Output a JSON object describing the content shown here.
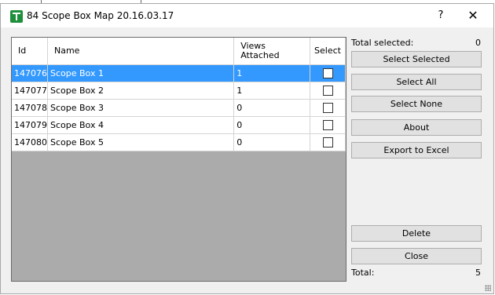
{
  "window": {
    "title": "84 Scope Box Map 20.16.03.17",
    "help_glyph": "?",
    "close_glyph": "✕",
    "icon": "app-logo-icon"
  },
  "grid": {
    "columns": [
      {
        "key": "id",
        "label": "Id"
      },
      {
        "key": "name",
        "label": "Name"
      },
      {
        "key": "views",
        "label": "Views\nAttached"
      },
      {
        "key": "select",
        "label": "Select"
      }
    ],
    "rows": [
      {
        "id": "147076",
        "name": "Scope Box 1",
        "views": "1",
        "checked": false,
        "selected": true
      },
      {
        "id": "147077",
        "name": "Scope Box 2",
        "views": "1",
        "checked": false,
        "selected": false
      },
      {
        "id": "147078",
        "name": "Scope Box 3",
        "views": "0",
        "checked": false,
        "selected": false
      },
      {
        "id": "147079",
        "name": "Scope Box 4",
        "views": "0",
        "checked": false,
        "selected": false
      },
      {
        "id": "147080",
        "name": "Scope Box 5",
        "views": "0",
        "checked": false,
        "selected": false
      }
    ]
  },
  "summary": {
    "total_selected_label": "Total selected:",
    "total_selected_value": "0",
    "total_label": "Total:",
    "total_value": "5"
  },
  "buttons": {
    "select_selected": "Select Selected",
    "select_all": "Select All",
    "select_none": "Select None",
    "about": "About",
    "export": "Export to Excel",
    "delete": "Delete",
    "close": "Close"
  },
  "colors": {
    "selection": "#3399ff",
    "grid_background": "#ababab",
    "dialog_background": "#f0f0f0",
    "icon_green": "#1e8f3a"
  }
}
